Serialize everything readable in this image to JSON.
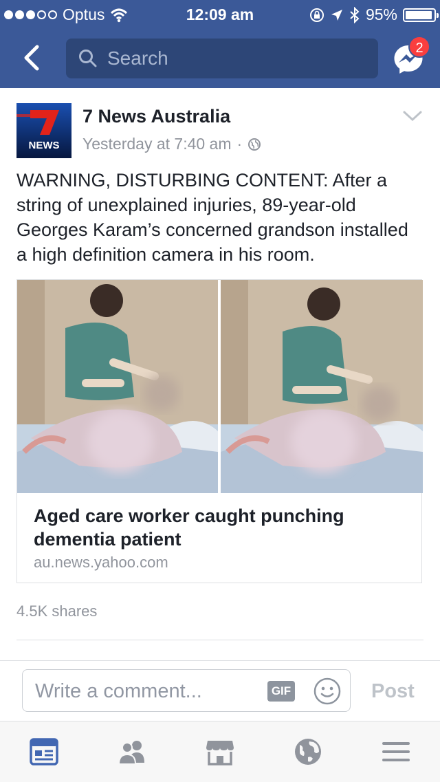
{
  "status_bar": {
    "carrier": "Optus",
    "time": "12:09 am",
    "battery": "95%",
    "battery_level": 0.95,
    "signal_bars": 3
  },
  "nav": {
    "search_placeholder": "Search",
    "messages_badge": "2"
  },
  "post": {
    "page_name": "7 News Australia",
    "logo_text": "NEWS",
    "timestamp": "Yesterday at 7:40 am",
    "separator": "·",
    "audience_icon": "globe-icon",
    "text": "WARNING, DISTURBING CONTENT: After a string of unexplained injuries, 89-year-old Georges Karam’s concerned grandson installed a high definition camera in his room.",
    "link": {
      "title": "Aged care worker caught punching dementia patient",
      "domain": "au.news.yahoo.com"
    },
    "shares": "4.5K shares"
  },
  "comment": {
    "placeholder": "Write a comment...",
    "gif_label": "GIF",
    "post_label": "Post"
  },
  "tabs": [
    "news-feed-icon",
    "friends-icon",
    "marketplace-icon",
    "notifications-globe-icon",
    "menu-icon"
  ],
  "colors": {
    "brand": "#3b5998",
    "active_tab": "#4267b2",
    "inactive_tab": "#90949c",
    "badge": "#fa3e3e"
  }
}
